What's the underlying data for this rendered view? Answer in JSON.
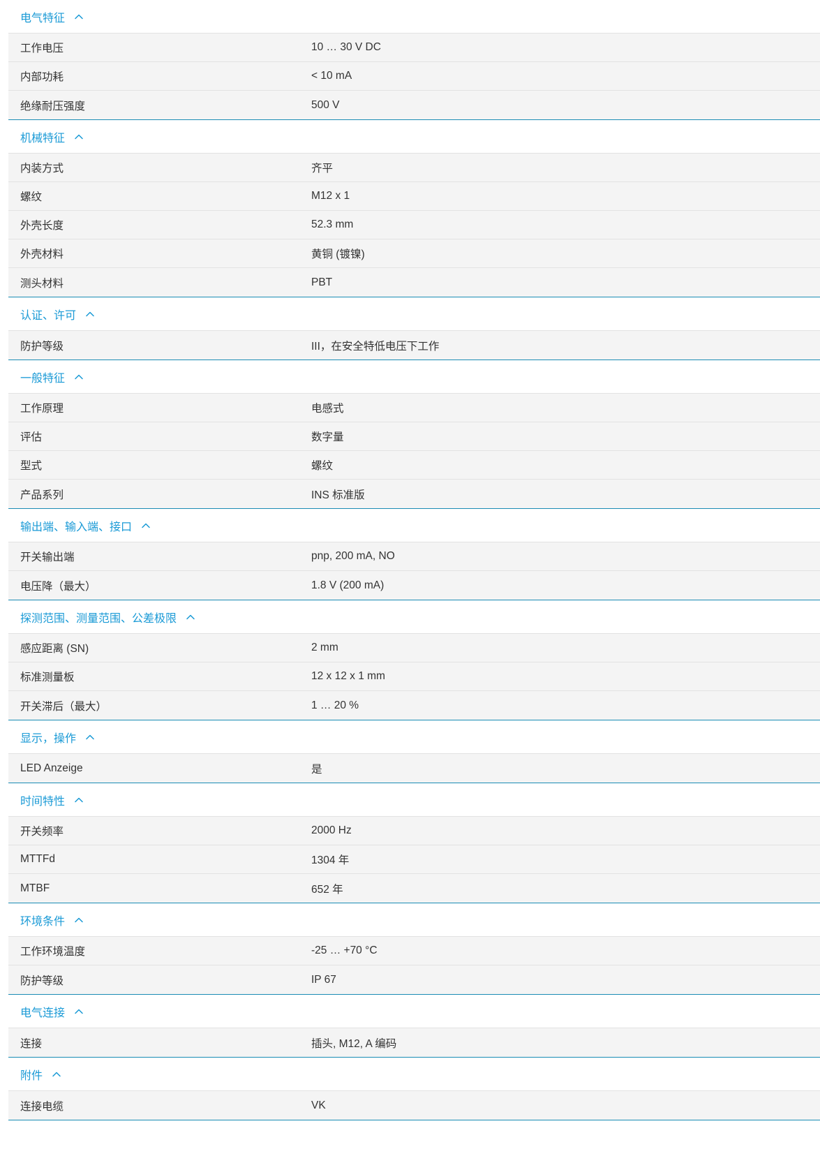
{
  "theme": {
    "accent": "#1a9ad6",
    "divider": "#1a8cb4",
    "row_background": "#f4f4f4",
    "text": "#333333"
  },
  "sections": [
    {
      "title": "电气特征",
      "rows": [
        {
          "label": "工作电压",
          "value": "10 … 30 V DC"
        },
        {
          "label": "内部功耗",
          "value": "< 10 mA"
        },
        {
          "label": "绝缘耐压强度",
          "value": "500 V"
        }
      ]
    },
    {
      "title": "机械特征",
      "rows": [
        {
          "label": "内装方式",
          "value": "齐平"
        },
        {
          "label": "螺纹",
          "value": "M12 x 1"
        },
        {
          "label": "外壳长度",
          "value": "52.3 mm"
        },
        {
          "label": "外壳材料",
          "value": "黄铜 (镀镍)"
        },
        {
          "label": "测头材料",
          "value": "PBT"
        }
      ]
    },
    {
      "title": "认证、许可",
      "rows": [
        {
          "label": "防护等级",
          "value": "III，在安全特低电压下工作"
        }
      ]
    },
    {
      "title": "一般特征",
      "rows": [
        {
          "label": "工作原理",
          "value": "电感式"
        },
        {
          "label": "评估",
          "value": "数字量"
        },
        {
          "label": "型式",
          "value": "螺纹"
        },
        {
          "label": "产品系列",
          "value": "INS 标准版"
        }
      ]
    },
    {
      "title": "输出端、输入端、接口",
      "rows": [
        {
          "label": "开关输出端",
          "value": "pnp, 200 mA, NO"
        },
        {
          "label": "电压降（最大）",
          "value": "1.8 V (200 mA)"
        }
      ]
    },
    {
      "title": "探测范围、测量范围、公差极限",
      "rows": [
        {
          "label": "感应距离 (SN)",
          "value": "2 mm"
        },
        {
          "label": "标准测量板",
          "value": "12 x 12 x 1 mm"
        },
        {
          "label": "开关滞后（最大）",
          "value": "1 … 20 %"
        }
      ]
    },
    {
      "title": "显示，操作",
      "rows": [
        {
          "label": "LED Anzeige",
          "value": "是"
        }
      ]
    },
    {
      "title": "时间特性",
      "rows": [
        {
          "label": "开关频率",
          "value": "2000 Hz"
        },
        {
          "label": "MTTFd",
          "value": "1304 年"
        },
        {
          "label": "MTBF",
          "value": "652 年"
        }
      ]
    },
    {
      "title": "环境条件",
      "rows": [
        {
          "label": "工作环境温度",
          "value": "-25 … +70 °C"
        },
        {
          "label": "防护等级",
          "value": "IP 67"
        }
      ]
    },
    {
      "title": "电气连接",
      "rows": [
        {
          "label": "连接",
          "value": "插头, M12, A 编码"
        }
      ]
    },
    {
      "title": "附件",
      "rows": [
        {
          "label": "连接电缆",
          "value": "VK"
        }
      ]
    }
  ]
}
